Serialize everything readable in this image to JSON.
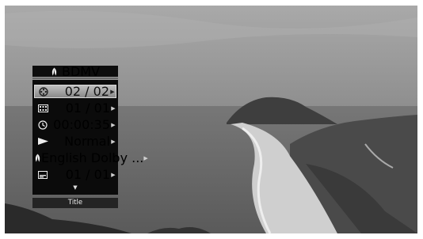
{
  "header": {
    "label": "BDMV",
    "icon": "disc-logo-icon"
  },
  "items": [
    {
      "icon": "title-reel-icon",
      "value": "02 / 02"
    },
    {
      "icon": "chapter-film-icon",
      "value": "01 / 01"
    },
    {
      "icon": "time-clock-icon",
      "value": "00:00:35"
    },
    {
      "icon": "play-mode-icon",
      "value": "Normal"
    },
    {
      "icon": "audio-icon",
      "value": "English Dolby ..."
    },
    {
      "icon": "subtitle-icon",
      "value": "01 / 01"
    }
  ],
  "footer": {
    "label": "Title"
  },
  "colors": {
    "panel": "#0b0b0b",
    "selected": "#a8a8a8",
    "text": "#f2f2f2"
  }
}
